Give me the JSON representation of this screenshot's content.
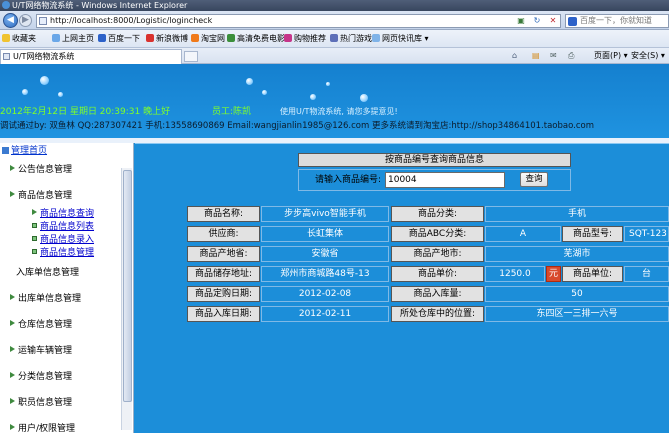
{
  "browser": {
    "window_title": "U/T网络物流系统 - Windows Internet Explorer",
    "address": "http://localhost:8000/Logistic/logincheck",
    "search_placeholder": "百度一下，你就知道",
    "favorites": [
      "收藏夹",
      "上网主页",
      "百度一下",
      "新浪微博",
      "淘宝网",
      "高清免费电影",
      "购物推荐",
      "热门游戏",
      "网页快讯库 ▾"
    ],
    "tab_title": "U/T网络物流系统",
    "tools": [
      "页面(P) ▾",
      "安全(S) ▾"
    ],
    "colors": {
      "titlebar": "#38465e",
      "accent": "#1c8ed9"
    }
  },
  "banner": {
    "datetime": "2012年2月12日 星期日 20:39:31 晚上好",
    "staff": "员工:陈凯",
    "welcome": "使用U/T物流系统, 请您多提意见!",
    "debug_line": "调试通过by: 双鱼林 QQ:287307421 手机:13558690869 Email:wangjianlin1985@126.com 更多系统请到淘宝店:http://shop34864101.taobao.com"
  },
  "sidebar": {
    "home": "管理首页",
    "items": [
      "公告信息管理",
      "商品信息管理",
      "入库单信息管理",
      "出库单信息管理",
      "仓库信息管理",
      "运输车辆管理",
      "分类信息管理",
      "职员信息管理",
      "用户/权限管理"
    ],
    "sub_items": [
      "商品信息查询",
      "商品信息列表",
      "商品信息录入",
      "商品信息管理"
    ]
  },
  "query": {
    "title": "按商品编号查询商品信息",
    "label": "请输入商品编号:",
    "value": "10004",
    "button": "查询"
  },
  "details": {
    "name_label": "商品名称:",
    "name": "步步高vivo智能手机",
    "category_label": "商品分类:",
    "category": "手机",
    "supplier_label": "供应商:",
    "supplier": "长虹集体",
    "abc_label": "商品ABC分类:",
    "abc": "A",
    "model_label": "商品型号:",
    "model": "SQT-123",
    "origin_province_label": "商品产地省:",
    "origin_province": "安徽省",
    "origin_city_label": "商品产地市:",
    "origin_city": "芜湖市",
    "storage_label": "商品储存地址:",
    "storage": "郑州市商城路48号-13",
    "price_label": "商品单价:",
    "price": "1250.0",
    "currency": "元",
    "unit_label": "商品单位:",
    "unit": "台",
    "order_date_label": "商品定购日期:",
    "order_date": "2012-02-08",
    "in_qty_label": "商品入库量:",
    "in_qty": "50",
    "in_date_label": "商品入库日期:",
    "in_date": "2012-02-11",
    "location_label": "所处仓库中的位置:",
    "location": "东四区一三排一六号"
  }
}
